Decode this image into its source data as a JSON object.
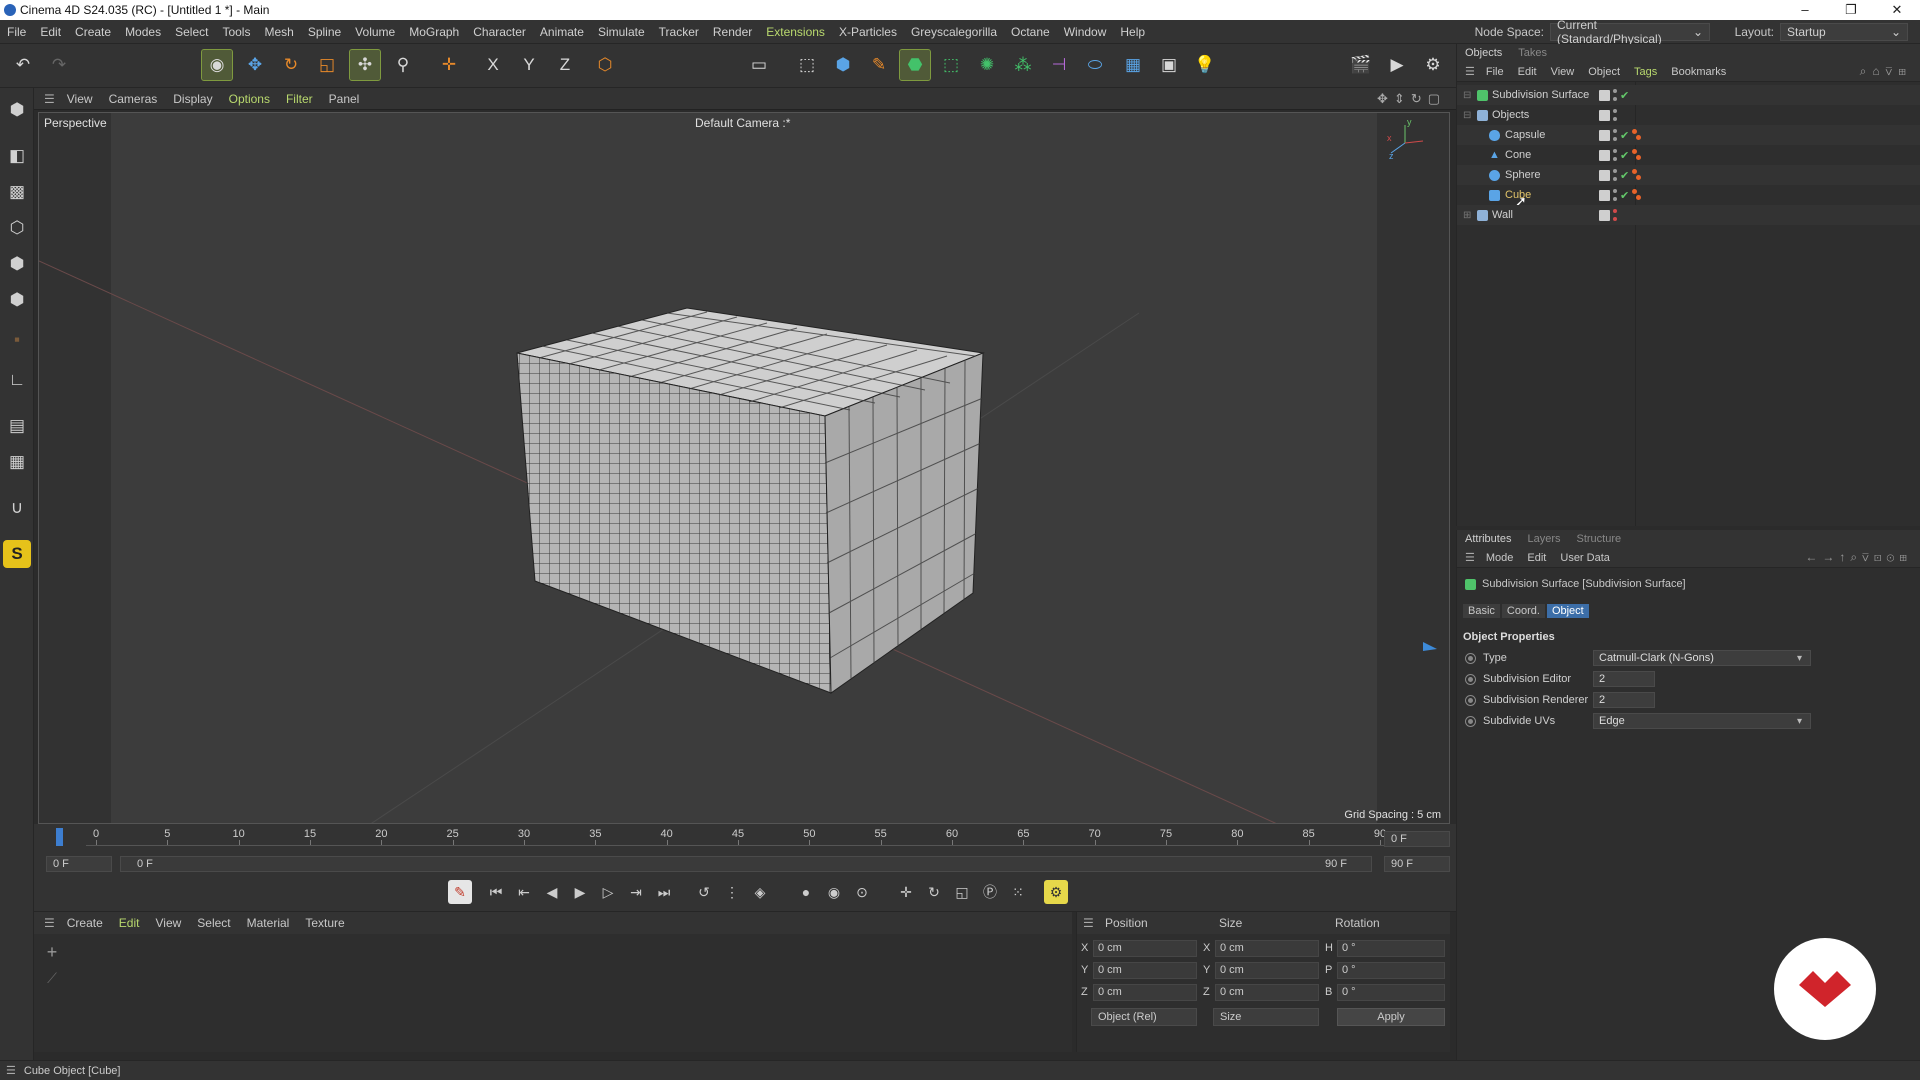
{
  "window": {
    "title": "Cinema 4D S24.035 (RC) - [Untitled 1 *] - Main",
    "controls": [
      "–",
      "❐",
      "✕"
    ]
  },
  "menubar": {
    "items": [
      "File",
      "Edit",
      "Create",
      "Modes",
      "Select",
      "Tools",
      "Mesh",
      "Spline",
      "Volume",
      "MoGraph",
      "Character",
      "Animate",
      "Simulate",
      "Tracker",
      "Render",
      "Extensions",
      "X-Particles",
      "Greyscalegorilla",
      "Octane",
      "Window",
      "Help"
    ],
    "node_space_label": "Node Space:",
    "node_space_value": "Current (Standard/Physical)",
    "layout_label": "Layout:",
    "layout_value": "Startup"
  },
  "viewport": {
    "menu": [
      "View",
      "Cameras",
      "Display",
      "Options",
      "Filter",
      "Panel"
    ],
    "view_name": "Perspective",
    "camera": "Default Camera :*",
    "grid_spacing": "Grid Spacing : 5 cm",
    "axis": {
      "x": "x",
      "y": "y",
      "z": "z"
    }
  },
  "timeline": {
    "ticks": [
      "0",
      "5",
      "10",
      "15",
      "20",
      "25",
      "30",
      "35",
      "40",
      "45",
      "50",
      "55",
      "60",
      "65",
      "70",
      "75",
      "80",
      "85",
      "90"
    ],
    "current_frame": "0 F",
    "start_frame": "0 F",
    "range_start": "0 F",
    "range_end": "90 F",
    "end_frame": "90 F",
    "max_frame": "90 F"
  },
  "material_manager": {
    "menu": [
      "Create",
      "Edit",
      "View",
      "Select",
      "Material",
      "Texture"
    ]
  },
  "coordinates": {
    "headers": {
      "position": "Position",
      "size": "Size",
      "rotation": "Rotation"
    },
    "rows": [
      {
        "axis": "X",
        "pos": "0 cm",
        "size_axis": "X",
        "size": "0 cm",
        "rot_axis": "H",
        "rot": "0 °"
      },
      {
        "axis": "Y",
        "pos": "0 cm",
        "size_axis": "Y",
        "size": "0 cm",
        "rot_axis": "P",
        "rot": "0 °"
      },
      {
        "axis": "Z",
        "pos": "0 cm",
        "size_axis": "Z",
        "size": "0 cm",
        "rot_axis": "B",
        "rot": "0 °"
      }
    ],
    "mode": "Object (Rel)",
    "size_mode": "Size",
    "apply": "Apply"
  },
  "status": {
    "text": "Cube Object [Cube]"
  },
  "object_manager": {
    "tabs": [
      "Objects",
      "Takes"
    ],
    "menu": [
      "File",
      "Edit",
      "View",
      "Object",
      "Tags",
      "Bookmarks"
    ],
    "objects": [
      {
        "name": "Subdivision Surface",
        "icon_color": "#4fc36a",
        "level": 0
      },
      {
        "name": "Objects",
        "icon_color": "#8fb2d8",
        "level": 0
      },
      {
        "name": "Capsule",
        "icon_color": "#5aa4e6",
        "level": 1
      },
      {
        "name": "Cone",
        "icon_color": "#5aa4e6",
        "level": 1
      },
      {
        "name": "Sphere",
        "icon_color": "#5aa4e6",
        "level": 1
      },
      {
        "name": "Cube",
        "icon_color": "#5aa4e6",
        "level": 1
      },
      {
        "name": "Wall",
        "icon_color": "#8fb2d8",
        "level": 0
      }
    ]
  },
  "attributes": {
    "tabs": [
      "Attributes",
      "Layers",
      "Structure"
    ],
    "menu": [
      "Mode",
      "Edit",
      "User Data"
    ],
    "object_title": "Subdivision Surface [Subdivision Surface]",
    "subtabs": [
      "Basic",
      "Coord.",
      "Object"
    ],
    "section": "Object Properties",
    "fields": [
      {
        "label": "Type",
        "value": "Catmull-Clark (N-Gons)"
      },
      {
        "label": "Subdivision Editor",
        "value": "2"
      },
      {
        "label": "Subdivision Renderer",
        "value": "2"
      },
      {
        "label": "Subdivide UVs",
        "value": "Edge"
      }
    ]
  },
  "colors": {
    "accent_green": "#b9d96e",
    "selection_blue": "#3c6ea8",
    "playhead": "#3d7ed0",
    "logo_red": "#d0242b"
  }
}
